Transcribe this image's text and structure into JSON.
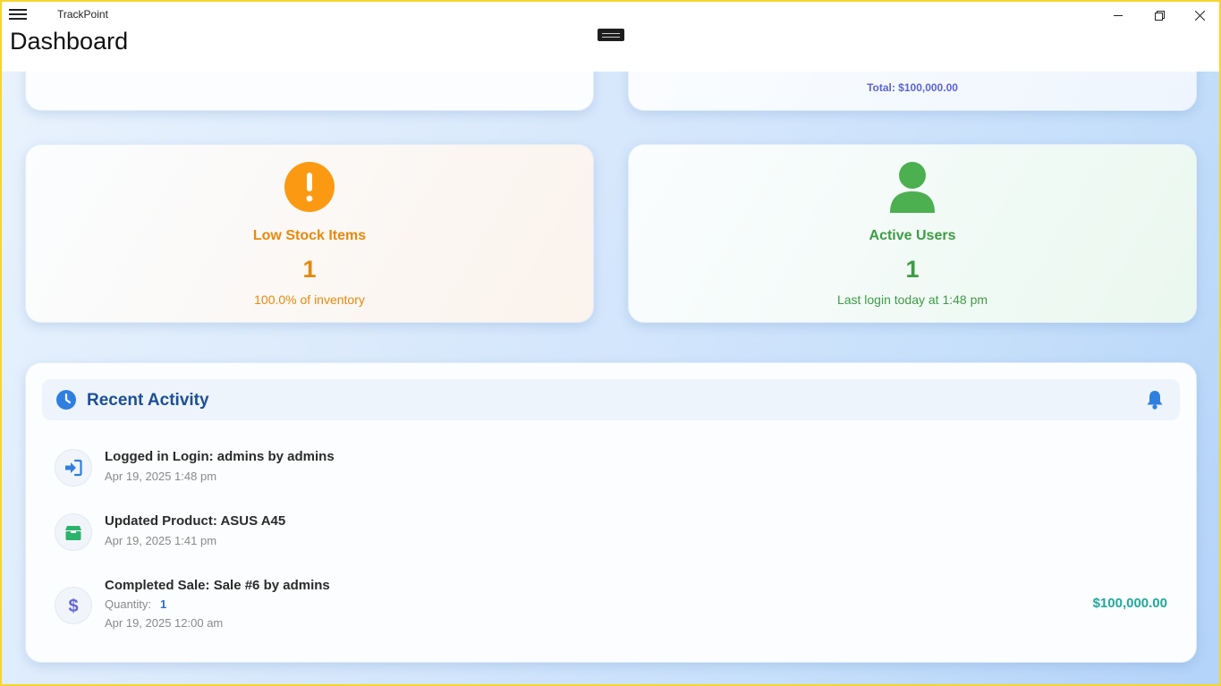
{
  "window": {
    "app_title": "TrackPoint",
    "page_title": "Dashboard"
  },
  "top_card": {
    "total_text": "Total: $100,000.00"
  },
  "low_stock": {
    "title": "Low Stock Items",
    "value": "1",
    "subtitle": "100.0% of inventory",
    "color": "#e8890c",
    "icon": "exclamation-circle-icon"
  },
  "active_users": {
    "title": "Active Users",
    "value": "1",
    "subtitle": "Last login today at 1:48 pm",
    "color": "#3f9b45",
    "icon": "user-icon"
  },
  "recent_activity": {
    "title": "Recent Activity",
    "items": [
      {
        "icon": "login-icon",
        "text": "Logged in Login: admins by admins",
        "date": "Apr 19, 2025 1:48 pm"
      },
      {
        "icon": "box-icon",
        "text": "Updated Product: ASUS A45",
        "date": "Apr 19, 2025 1:41 pm"
      },
      {
        "icon": "dollar-icon",
        "text": "Completed Sale: Sale #6 by admins",
        "quantity_label": "Quantity:",
        "quantity": "1",
        "date": "Apr 19, 2025 12:00 am",
        "amount": "$100,000.00"
      }
    ]
  }
}
